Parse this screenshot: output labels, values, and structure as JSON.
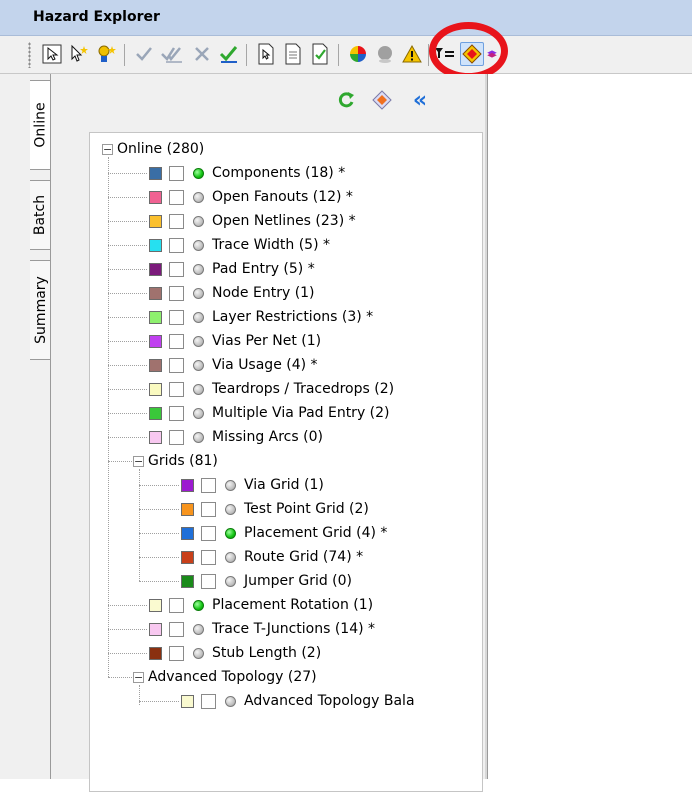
{
  "window": {
    "title": "Hazard Explorer"
  },
  "toolbar": {
    "buttons": [
      {
        "name": "select-arrow-button",
        "icon": "select-arrow-icon"
      },
      {
        "name": "select-pointer-button",
        "icon": "pointer-star-icon"
      },
      {
        "name": "select-person-button",
        "icon": "person-star-icon"
      },
      {
        "name": "approve-button",
        "icon": "checkmark-icon"
      },
      {
        "name": "approve-all-button",
        "icon": "double-checkmark-icon"
      },
      {
        "name": "reject-button",
        "icon": "x-mark-icon"
      },
      {
        "name": "approve-selected-button",
        "icon": "green-checkmark-icon"
      },
      {
        "name": "report-button",
        "icon": "report-icon"
      },
      {
        "name": "document-button",
        "icon": "document-icon"
      },
      {
        "name": "document-check-button",
        "icon": "document-check-icon"
      },
      {
        "name": "color-button",
        "icon": "color-wheel-icon"
      },
      {
        "name": "shade-button",
        "icon": "grey-ball-icon"
      },
      {
        "name": "warning-button",
        "icon": "warning-icon"
      },
      {
        "name": "filter-button",
        "icon": "filter-icon"
      },
      {
        "name": "hazard-diamond-button",
        "icon": "diamond-icon"
      },
      {
        "name": "layers-button",
        "icon": "layers-icon"
      }
    ]
  },
  "side_tabs": [
    {
      "label": "Online",
      "active": true
    },
    {
      "label": "Batch",
      "active": false
    },
    {
      "label": "Summary",
      "active": false
    }
  ],
  "panel_tools": [
    {
      "name": "refresh-button",
      "icon": "refresh-icon"
    },
    {
      "name": "hazard-filter-button",
      "icon": "diamond-icon"
    },
    {
      "name": "collapse-panel-button",
      "icon": "double-chevron-left-icon",
      "glyph": "«"
    }
  ],
  "tree": {
    "root": {
      "label": "Online (280)",
      "expander": "−"
    },
    "online_items": [
      {
        "label": "Components (18) *",
        "color": "#3a6ea5",
        "status": "green"
      },
      {
        "label": "Open Fanouts (12) *",
        "color": "#f06292",
        "status": "grey"
      },
      {
        "label": "Open Netlines (23) *",
        "color": "#fbc02d",
        "status": "grey"
      },
      {
        "label": "Trace Width (5) *",
        "color": "#26e0f0",
        "status": "grey"
      },
      {
        "label": "Pad Entry (5) *",
        "color": "#7b1a7b",
        "status": "grey"
      },
      {
        "label": "Node Entry (1)",
        "color": "#a0726e",
        "status": "grey"
      },
      {
        "label": "Layer Restrictions (3) *",
        "color": "#8ef06e",
        "status": "grey"
      },
      {
        "label": "Vias Per Net (1)",
        "color": "#c040f0",
        "status": "grey"
      },
      {
        "label": "Via Usage (4) *",
        "color": "#a0726e",
        "status": "grey"
      },
      {
        "label": "Teardrops / Tracedrops (2)",
        "color": "#fafac0",
        "status": "grey"
      },
      {
        "label": "Multiple Via Pad Entry (2)",
        "color": "#3ac83a",
        "status": "grey"
      },
      {
        "label": "Missing Arcs (0)",
        "color": "#f8c8f0",
        "status": "grey"
      }
    ],
    "grids": {
      "label": "Grids (81)",
      "expander": "−"
    },
    "grid_items": [
      {
        "label": "Via Grid (1)",
        "color": "#9c1ad0",
        "status": "grey"
      },
      {
        "label": "Test Point Grid (2)",
        "color": "#f7941d",
        "status": "grey"
      },
      {
        "label": "Placement Grid (4) *",
        "color": "#1f6fd8",
        "status": "green"
      },
      {
        "label": "Route Grid (74) *",
        "color": "#c8401a",
        "status": "grey"
      },
      {
        "label": "Jumper Grid (0)",
        "color": "#1a8a1a",
        "status": "grey"
      }
    ],
    "after_grids": [
      {
        "label": "Placement Rotation (1)",
        "color": "#fafad0",
        "status": "green"
      },
      {
        "label": "Trace T-Junctions (14) *",
        "color": "#f8c8f0",
        "status": "grey"
      },
      {
        "label": "Stub Length (2)",
        "color": "#8a3010",
        "status": "grey"
      }
    ],
    "advanced": {
      "label": "Advanced Topology (27)",
      "expander": "−"
    },
    "advanced_items": [
      {
        "label": "Advanced Topology Bala",
        "color": "#fafad0",
        "status": "grey"
      }
    ]
  }
}
